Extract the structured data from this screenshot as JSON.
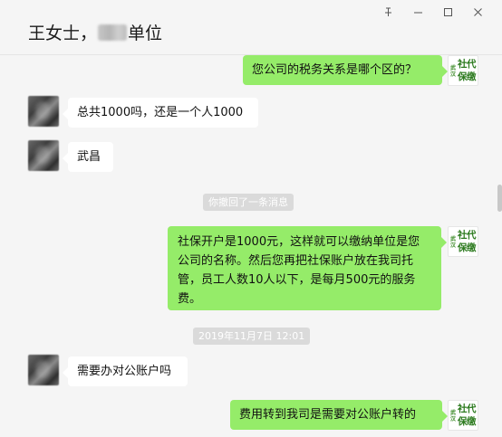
{
  "header": {
    "title_prefix": "王女士，",
    "title_suffix": "单位",
    "controls": [
      "pin-icon",
      "minimize-icon",
      "maximize-icon",
      "close-icon"
    ]
  },
  "brand_avatar": {
    "small_text": "武汉",
    "big_text": "社代保缴"
  },
  "messages": [
    {
      "side": "right",
      "text": "您公司的税务关系是哪个区的？"
    },
    {
      "side": "left",
      "text": "总共1000吗，还是一个人1000"
    },
    {
      "side": "left",
      "text": "武昌"
    },
    {
      "side": "system",
      "text": "你撤回了一条消息"
    },
    {
      "side": "right",
      "text": "社保开户是1000元，这样就可以缴纳单位是您公司的名称。然后您再把社保账户放在我司托管，员工人数10人以下，是每月500元的服务费。"
    },
    {
      "side": "system",
      "text": "2019年11月7日 12:01"
    },
    {
      "side": "left",
      "text": "需要办对公账户吗"
    },
    {
      "side": "right",
      "text": "费用转到我司是需要对公账户转的"
    }
  ],
  "colors": {
    "right_bubble": "#95ec69",
    "left_bubble": "#ffffff",
    "background": "#f5f5f5"
  }
}
